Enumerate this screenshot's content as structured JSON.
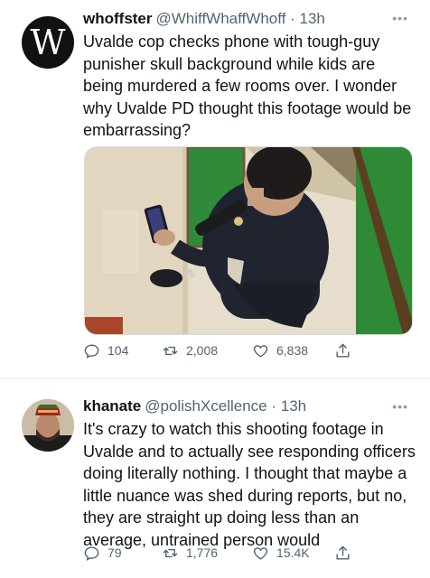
{
  "tweets": [
    {
      "name": "whoffster",
      "handle": "@WhiffWhaffWhoff",
      "time": "13h",
      "avatar_letter": "W",
      "text": "Uvalde cop checks phone with tough-guy punisher skull background while kids are being murdered a few rooms over. I wonder why Uvalde PD thought this footage would be embarrassing?",
      "replies": "104",
      "retweets": "2,008",
      "likes": "6,838"
    },
    {
      "name": "khanate",
      "handle": "@polishXcellence",
      "time": "13h",
      "text": "It's crazy to watch this shooting footage in Uvalde and to actually see responding officers doing literally nothing. I thought that maybe a little nuance was shed during reports, but no, they are straight up doing less than an average, untrained person would",
      "replies": "79",
      "retweets": "1,776",
      "likes": "15.4K"
    }
  ],
  "icons": {
    "reply": "reply-icon",
    "retweet": "retweet-icon",
    "like": "heart-icon",
    "share": "share-icon",
    "more": "more-icon"
  },
  "colors": {
    "text": "#0f1419",
    "muted": "#536471",
    "separator": "#eff3f4"
  }
}
